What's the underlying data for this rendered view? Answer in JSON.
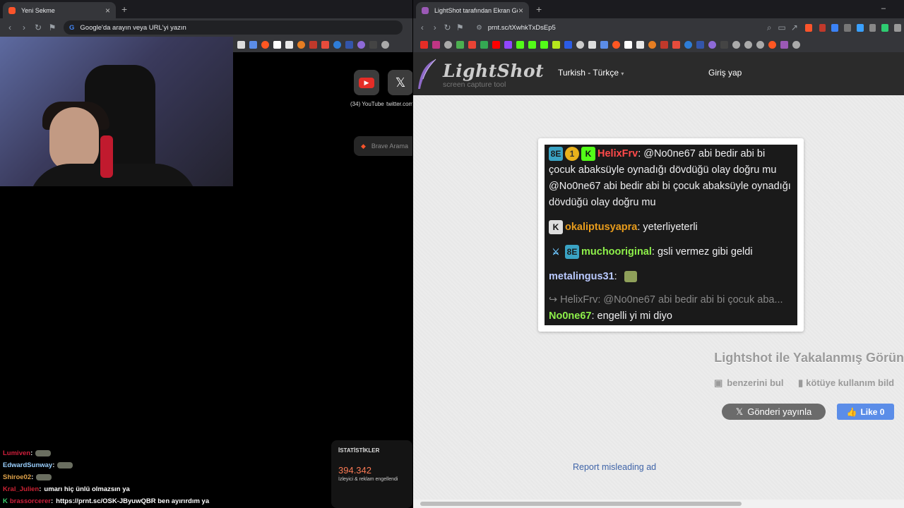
{
  "left": {
    "tab_title": "Yeni Sekme",
    "omnibox_placeholder": "Google'da arayın veya URL'yi yazın",
    "shortcuts": [
      {
        "label": "(34) YouTube",
        "icon": "youtube-icon"
      },
      {
        "label": "twitter.com",
        "icon": "x-icon"
      }
    ],
    "search_placeholder": "Brave Arama",
    "stats": {
      "title": "İSTATİSTİKLER",
      "value": "394.342",
      "label": "İzleyici & reklam engellendi"
    },
    "chat": [
      {
        "user": "Lumiven",
        "sep": " :",
        "msg": "",
        "color": "#d11f3c",
        "emote": true
      },
      {
        "user": "EdwardSunway",
        "sep": " :",
        "msg": "",
        "color": "#9ad0ff",
        "emote": true
      },
      {
        "user": "Shiroe02",
        "sep": " :",
        "msg": "",
        "color": "#e0a34a",
        "emote": true
      },
      {
        "user": "Kral_Julien",
        "sep": " :",
        "msg": "umarı hiç ünlü olmazsın ya",
        "color": "#cc2233",
        "emote": false
      },
      {
        "user": "brassorcerer",
        "sep": " :",
        "msg": "https://prnt.sc/OSK-JByuwQBR ben ayırırdım ya",
        "color": "#d11f3c",
        "emote": false,
        "badge": "K"
      }
    ]
  },
  "right": {
    "tab_title": "LightShot tarafından Ekran Görü",
    "url": "prnt.sc/tXwhkTxDsEp5",
    "logo": "LightShot",
    "logo_sub": "screen capture tool",
    "language": "Turkish - Türkçe",
    "login": "Giriş yap",
    "caption": "Lightshot ile Yakalanmış Görün",
    "similar": "benzerini bul",
    "report_abuse": "kötüye kullanım bild",
    "tweet": "Gönderi yayınla",
    "like": "Like 0",
    "report_ad": "Report misleading ad",
    "screenshot_chat": [
      {
        "user": "HelixFrv",
        "user_color": "#ff4a4a",
        "badges": [
          "8E",
          "1",
          "K"
        ],
        "msg": "@No0ne67 abi bedir abi bi çocuk abaksüyle oynadığı dövdüğü olay doğru mu @No0ne67 abi bedir abi bi çocuk abaksüyle oynadığı dövdüğü olay doğru mu"
      },
      {
        "user": "okaliptusyapra",
        "user_color": "#e89c1c",
        "badges": [
          "K"
        ],
        "msg": "yeterliyeterli"
      },
      {
        "user": "muchooriginal",
        "user_color": "#8ef04a",
        "badges": [
          "⚔",
          "8E"
        ],
        "msg": "gsli vermez gibi geldi"
      },
      {
        "user": "metalingus31",
        "user_color": "#b9c9ff",
        "badges": [],
        "msg": ""
      },
      {
        "reply": "↪ HelixFrv: @No0ne67 abi bedir abi bi çocuk aba..."
      },
      {
        "user": "No0ne67",
        "user_color": "#8ef04a",
        "badges": [],
        "msg": "engelli yi mi diyo"
      }
    ]
  }
}
